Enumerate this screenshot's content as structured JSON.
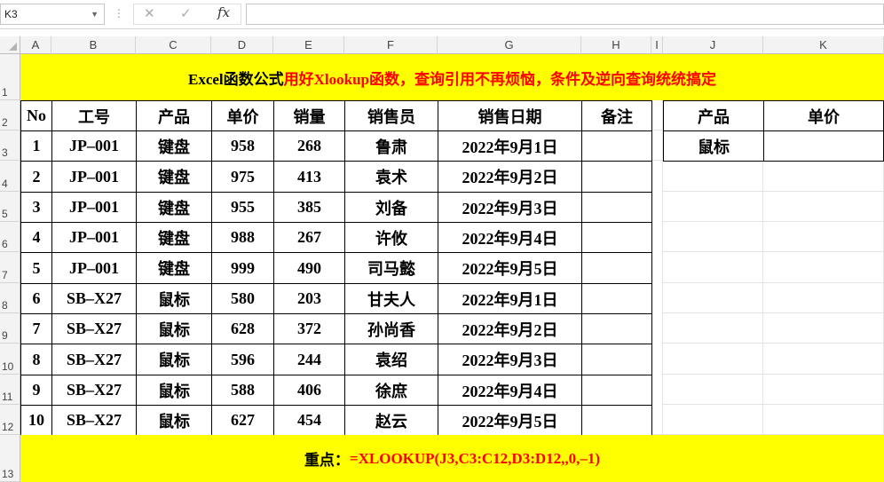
{
  "formula_bar": {
    "name_box": "K3",
    "formula": "",
    "fx": "fx"
  },
  "col_headers": [
    "A",
    "B",
    "C",
    "D",
    "E",
    "F",
    "G",
    "H",
    "I",
    "J",
    "K"
  ],
  "row_headers": [
    "1",
    "2",
    "3",
    "4",
    "5",
    "6",
    "7",
    "8",
    "9",
    "10",
    "11",
    "12",
    "13"
  ],
  "title": {
    "black": "Excel函数公式",
    "red": "用好Xlookup函数，查询引用不再烦恼，条件及逆向查询统统搞定"
  },
  "table": {
    "headers": [
      "No",
      "工号",
      "产品",
      "单价",
      "销量",
      "销售员",
      "销售日期",
      "备注"
    ],
    "rows": [
      [
        "1",
        "JP–001",
        "键盘",
        "958",
        "268",
        "鲁肃",
        "2022年9月1日",
        ""
      ],
      [
        "2",
        "JP–001",
        "键盘",
        "975",
        "413",
        "袁术",
        "2022年9月2日",
        ""
      ],
      [
        "3",
        "JP–001",
        "键盘",
        "955",
        "385",
        "刘备",
        "2022年9月3日",
        ""
      ],
      [
        "4",
        "JP–001",
        "键盘",
        "988",
        "267",
        "许攸",
        "2022年9月4日",
        ""
      ],
      [
        "5",
        "JP–001",
        "键盘",
        "999",
        "490",
        "司马懿",
        "2022年9月5日",
        ""
      ],
      [
        "6",
        "SB–X27",
        "鼠标",
        "580",
        "203",
        "甘夫人",
        "2022年9月1日",
        ""
      ],
      [
        "7",
        "SB–X27",
        "鼠标",
        "628",
        "372",
        "孙尚香",
        "2022年9月2日",
        ""
      ],
      [
        "8",
        "SB–X27",
        "鼠标",
        "596",
        "244",
        "袁绍",
        "2022年9月3日",
        ""
      ],
      [
        "9",
        "SB–X27",
        "鼠标",
        "588",
        "406",
        "徐庶",
        "2022年9月4日",
        ""
      ],
      [
        "10",
        "SB–X27",
        "鼠标",
        "627",
        "454",
        "赵云",
        "2022年9月5日",
        ""
      ]
    ]
  },
  "lookup": {
    "headers": [
      "产品",
      "单价"
    ],
    "values": [
      "鼠标",
      ""
    ]
  },
  "footer": {
    "black": "重点：",
    "red": "=XLOOKUP(J3,C3:C12,D3:D12,,0,–1)"
  },
  "colors": {
    "highlight": "#ffff00",
    "accent_red": "#ff0000"
  }
}
